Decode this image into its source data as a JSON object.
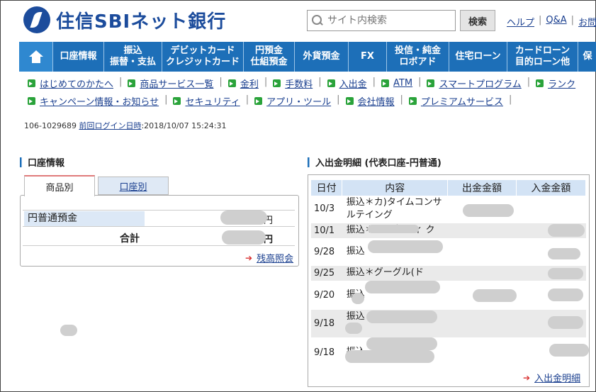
{
  "header": {
    "logo_text": "住信SBIネット銀行",
    "search_placeholder": "サイト内検索",
    "search_button": "検索",
    "links": [
      "ヘルプ",
      "Q&A",
      "お問"
    ]
  },
  "nav": {
    "items": [
      "口座情報",
      "振込\n振替・支払",
      "デビットカード\nクレジットカード",
      "円預金\n仕組預金",
      "外貨預金",
      "FX",
      "投信・純金\nロボアド",
      "住宅ローン",
      "カードローン\n目的ローン他",
      "保"
    ]
  },
  "sublinks": {
    "row1": [
      "はじめてのかたへ",
      "商品サービス一覧",
      "金利",
      "手数料",
      "入出金",
      "ATM",
      "スマートプログラム",
      "ランク"
    ],
    "row2": [
      "キャンペーン情報・お知らせ",
      "セキュリティ",
      "アプリ・ツール",
      "会社情報",
      "プレミアムサービス"
    ]
  },
  "account": {
    "number": "106-1029689",
    "last_login_label": "前回ログイン日時",
    "last_login_value": ":2018/10/07 15:24:31"
  },
  "left": {
    "title": "口座情報",
    "tab_active": "商品別",
    "tab_inactive": "口座別",
    "row_label": "円普通預金",
    "total_label": "合計",
    "yen": "円",
    "balance_link": "残高照会"
  },
  "right": {
    "title": "入出金明細 (代表口座-円普通)",
    "columns": [
      "日付",
      "内容",
      "出金金額",
      "入金金額"
    ],
    "rows": [
      {
        "date": "10/3",
        "content": "振込＊カ)タイムコンサルテイング"
      },
      {
        "date": "10/1",
        "content": "振込＊ ニ ブ ー ィ ク"
      },
      {
        "date": "9/28",
        "content": "振込"
      },
      {
        "date": "9/25",
        "content": "振込＊グーグル(ド"
      },
      {
        "date": "9/20",
        "content": "振込"
      },
      {
        "date": "9/18",
        "content": "振込　　　　　　　　　　ャ"
      },
      {
        "date": "9/18",
        "content": "振込"
      }
    ],
    "link": "入出金明細"
  }
}
